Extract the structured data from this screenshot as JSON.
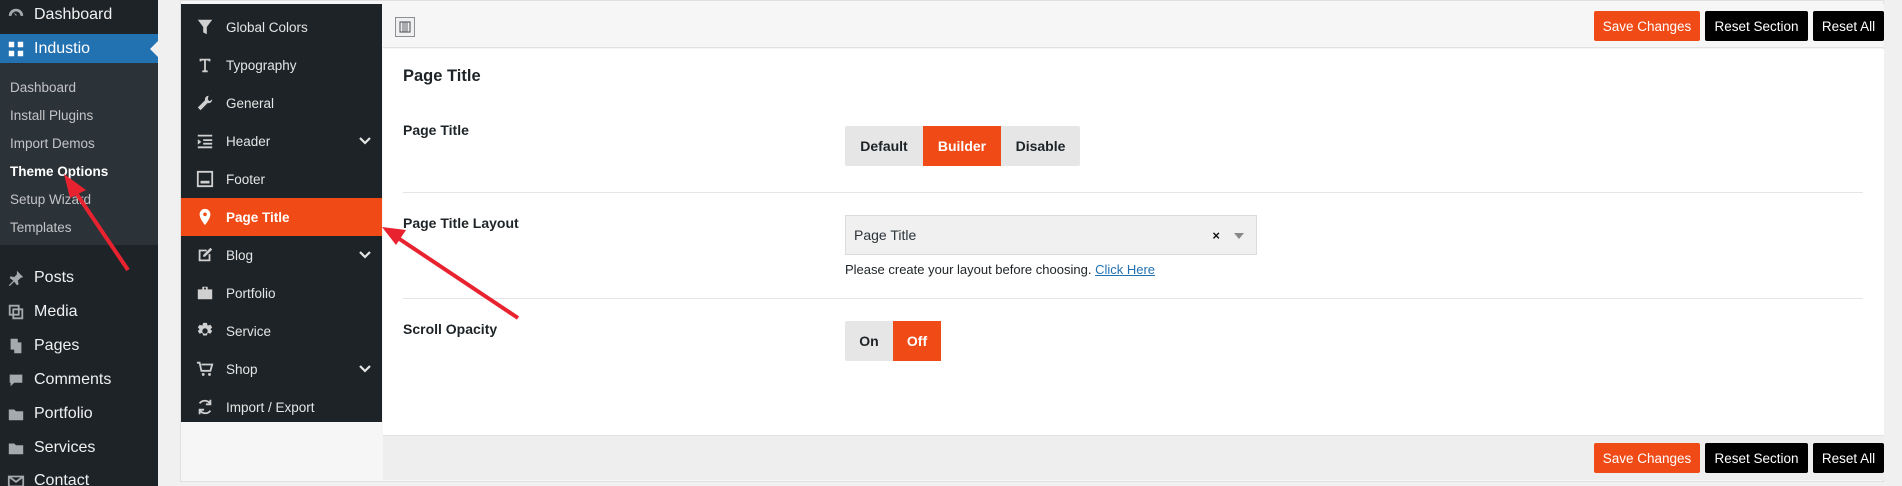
{
  "wp_menu": {
    "top": [
      {
        "label": "Dashboard",
        "icon": "dashboard-icon"
      },
      {
        "label": "Industio",
        "icon": "industio-icon",
        "active": true
      }
    ],
    "submenu": [
      "Dashboard",
      "Install Plugins",
      "Import Demos",
      "Theme Options",
      "Setup Wizard",
      "Templates"
    ],
    "current_submenu": "Theme Options",
    "bottom": [
      {
        "label": "Posts",
        "icon": "pin-icon"
      },
      {
        "label": "Media",
        "icon": "media-icon"
      },
      {
        "label": "Pages",
        "icon": "pages-icon"
      },
      {
        "label": "Comments",
        "icon": "comments-icon"
      },
      {
        "label": "Portfolio",
        "icon": "folder-icon"
      },
      {
        "label": "Services",
        "icon": "folder-icon"
      },
      {
        "label": "Contact",
        "icon": "mail-icon"
      }
    ]
  },
  "options_nav": [
    {
      "label": "Global Colors",
      "icon": "filter-icon"
    },
    {
      "label": "Typography",
      "icon": "typography-icon"
    },
    {
      "label": "General",
      "icon": "wrench-icon"
    },
    {
      "label": "Header",
      "icon": "header-icon",
      "expandable": true
    },
    {
      "label": "Footer",
      "icon": "footer-icon"
    },
    {
      "label": "Page Title",
      "icon": "location-pin-icon",
      "active": true
    },
    {
      "label": "Blog",
      "icon": "edit-icon",
      "expandable": true
    },
    {
      "label": "Portfolio",
      "icon": "briefcase-icon"
    },
    {
      "label": "Service",
      "icon": "gear-icon"
    },
    {
      "label": "Shop",
      "icon": "cart-icon",
      "expandable": true
    },
    {
      "label": "Import / Export",
      "icon": "refresh-icon"
    }
  ],
  "toolbar": {
    "save": "Save Changes",
    "reset_section": "Reset Section",
    "reset_all": "Reset All"
  },
  "section": {
    "title": "Page Title",
    "fields": {
      "page_title": {
        "label": "Page Title",
        "options": [
          "Default",
          "Builder",
          "Disable"
        ],
        "selected": "Builder"
      },
      "layout": {
        "label": "Page Title Layout",
        "value": "Page Title",
        "help": "Please create your layout before choosing.",
        "link": "Click Here"
      },
      "scroll_opacity": {
        "label": "Scroll Opacity",
        "options": [
          "On",
          "Off"
        ],
        "selected": "Off"
      }
    }
  },
  "colors": {
    "accent": "#f04a16",
    "wp_sidebar": "#1d2327",
    "wp_active": "#2271b1",
    "annotation_arrow": "#e8232f"
  }
}
